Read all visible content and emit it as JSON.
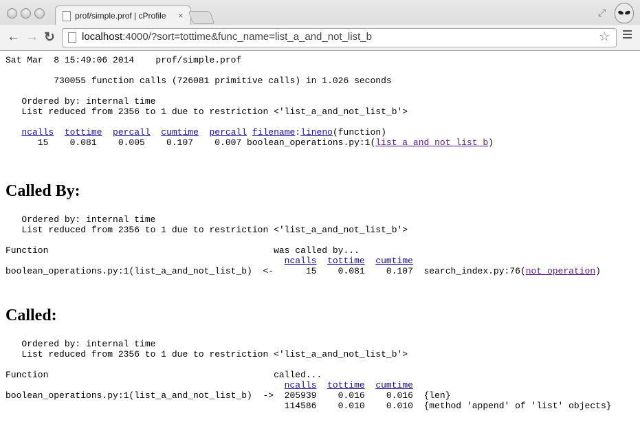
{
  "browser": {
    "tab_title": "prof/simple.prof | cProfile",
    "tab_close": "×",
    "url_host": "localhost",
    "url_rest": ":4000/?sort=tottime&func_name=list_a_and_not_list_b",
    "back": "←",
    "forward": "→",
    "reload": "↻",
    "star": "☆",
    "fullscreen": "⤢"
  },
  "header": {
    "line1": "Sat Mar  8 15:49:06 2014    prof/simple.prof",
    "line2": "         730055 function calls (726081 primitive calls) in 1.026 seconds"
  },
  "stats": {
    "ordered": "   Ordered by: internal time",
    "reduced": "   List reduced from 2356 to 1 due to restriction <'list_a_and_not_list_b'>",
    "headers": {
      "ncalls": "ncalls",
      "tottime": "tottime",
      "percall": "percall",
      "cumtime": "cumtime",
      "percall2": "percall",
      "filename": "filename",
      "lineno": "lineno",
      "function": "(function)"
    },
    "row": {
      "pre": "      15    0.081    0.005    0.107    0.007 boolean_operations.py:1(",
      "func": "list_a_and_not_list_b",
      "post": ")"
    }
  },
  "called_by": {
    "heading": "Called By:",
    "ordered": "   Ordered by: internal time",
    "reduced": "   List reduced from 2356 to 1 due to restriction <'list_a_and_not_list_b'>",
    "header_line": "Function                                          was called by...",
    "col_ncalls": "ncalls",
    "col_tottime": "tottime",
    "col_cumtime": "cumtime",
    "row_pre": "boolean_operations.py:1(list_a_and_not_list_b)  <-      15    0.081    0.107  search_index.py:76(",
    "row_link": "not_operation",
    "row_post": ")"
  },
  "called": {
    "heading": "Called:",
    "ordered": "   Ordered by: internal time",
    "reduced": "   List reduced from 2356 to 1 due to restriction <'list_a_and_not_list_b'>",
    "header_line": "Function                                          called...",
    "col_ncalls": "ncalls",
    "col_tottime": "tottime",
    "col_cumtime": "cumtime",
    "row1": "boolean_operations.py:1(list_a_and_not_list_b)  ->  205939    0.016    0.016  {len}",
    "row2": "                                                    114586    0.010    0.010  {method 'append' of 'list' objects}"
  }
}
